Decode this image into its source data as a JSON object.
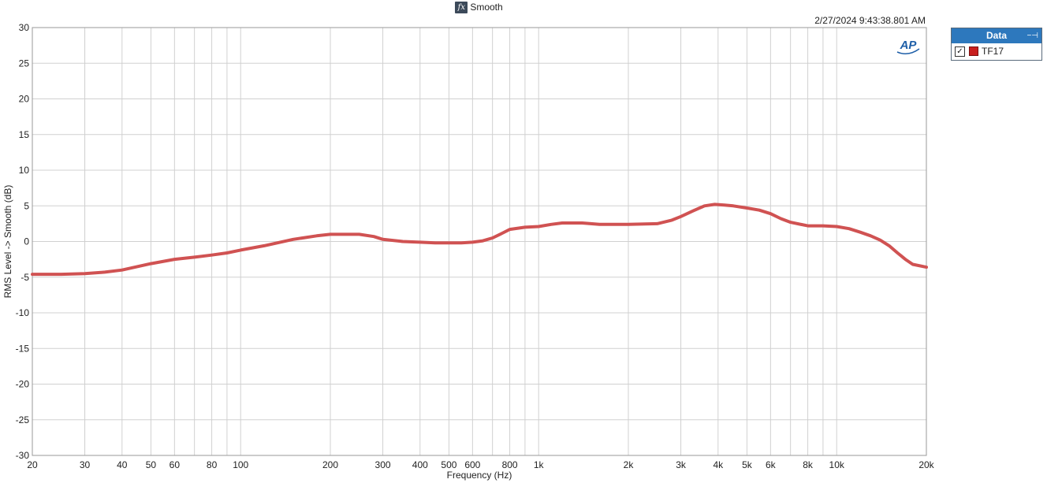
{
  "window": {
    "title": "Smooth",
    "timestamp": "2/27/2024 9:43:38.801 AM"
  },
  "icons": {
    "title_icon": "fx-function-icon",
    "brand": "ap-logo",
    "brand_text": "AP",
    "legend_pin": "pin-icon",
    "checkbox": "check-icon"
  },
  "legend": {
    "title": "Data",
    "items": [
      {
        "label": "TF17",
        "color": "#c81e1e",
        "checked": true
      }
    ]
  },
  "colors": {
    "series": "#d05252",
    "legend_header": "#2d78bd",
    "grid": "#d0d0d0",
    "brand": "#1e5fa8"
  },
  "chart_data": {
    "type": "line",
    "xscale": "log",
    "xlim": [
      20,
      20000
    ],
    "ylim": [
      -30,
      30
    ],
    "xlabel": "Frequency (Hz)",
    "ylabel": "RMS Level -> Smooth (dB)",
    "grid": true,
    "legend_position": "right-outside",
    "x_ticks": [
      {
        "v": 20,
        "label": "20"
      },
      {
        "v": 30,
        "label": "30"
      },
      {
        "v": 40,
        "label": "40"
      },
      {
        "v": 50,
        "label": "50"
      },
      {
        "v": 60,
        "label": "60"
      },
      {
        "v": 80,
        "label": "80"
      },
      {
        "v": 100,
        "label": "100"
      },
      {
        "v": 200,
        "label": "200"
      },
      {
        "v": 300,
        "label": "300"
      },
      {
        "v": 400,
        "label": "400"
      },
      {
        "v": 500,
        "label": "500"
      },
      {
        "v": 600,
        "label": "600"
      },
      {
        "v": 800,
        "label": "800"
      },
      {
        "v": 1000,
        "label": "1k"
      },
      {
        "v": 2000,
        "label": "2k"
      },
      {
        "v": 3000,
        "label": "3k"
      },
      {
        "v": 4000,
        "label": "4k"
      },
      {
        "v": 5000,
        "label": "5k"
      },
      {
        "v": 6000,
        "label": "6k"
      },
      {
        "v": 8000,
        "label": "8k"
      },
      {
        "v": 10000,
        "label": "10k"
      },
      {
        "v": 20000,
        "label": "20k"
      }
    ],
    "y_ticks": [
      30,
      25,
      20,
      15,
      10,
      5,
      0,
      -5,
      -10,
      -15,
      -20,
      -25,
      -30
    ],
    "series": [
      {
        "name": "TF17",
        "x": [
          20,
          25,
          30,
          35,
          40,
          50,
          60,
          70,
          80,
          90,
          100,
          120,
          150,
          180,
          200,
          250,
          280,
          300,
          350,
          400,
          450,
          500,
          550,
          600,
          650,
          700,
          750,
          800,
          900,
          1000,
          1100,
          1200,
          1400,
          1600,
          2000,
          2500,
          2800,
          3000,
          3300,
          3600,
          3900,
          4200,
          4500,
          5000,
          5500,
          6000,
          6500,
          7000,
          8000,
          9000,
          10000,
          11000,
          12000,
          13000,
          14000,
          15000,
          16000,
          17000,
          18000,
          20000
        ],
        "y": [
          -4.6,
          -4.6,
          -4.5,
          -4.3,
          -4.0,
          -3.1,
          -2.5,
          -2.2,
          -1.9,
          -1.6,
          -1.2,
          -0.6,
          0.3,
          0.8,
          1.0,
          1.0,
          0.7,
          0.3,
          0.0,
          -0.1,
          -0.2,
          -0.2,
          -0.2,
          -0.1,
          0.1,
          0.5,
          1.1,
          1.7,
          2.0,
          2.1,
          2.4,
          2.6,
          2.6,
          2.4,
          2.4,
          2.5,
          3.0,
          3.5,
          4.3,
          5.0,
          5.2,
          5.1,
          5.0,
          4.7,
          4.4,
          3.9,
          3.2,
          2.7,
          2.2,
          2.2,
          2.1,
          1.8,
          1.3,
          0.8,
          0.2,
          -0.6,
          -1.6,
          -2.5,
          -3.2,
          -3.6
        ]
      }
    ]
  }
}
